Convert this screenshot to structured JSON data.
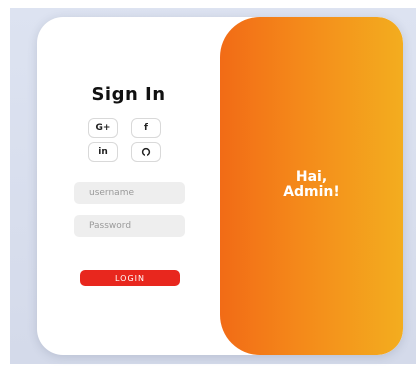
{
  "login": {
    "title": "Sign In",
    "social": [
      {
        "label": "G+",
        "icon": "google-plus-icon"
      },
      {
        "label": "f",
        "icon": "facebook-icon"
      },
      {
        "label": "in",
        "icon": "linkedin-icon"
      },
      {
        "label": "⚇",
        "icon": "github-icon"
      }
    ],
    "username_placeholder": "username",
    "password_placeholder": "Password",
    "login_label": "LOGIN"
  },
  "panel": {
    "greeting_line1": "Hai,",
    "greeting_line2": "Admin!"
  },
  "colors": {
    "accent_start": "#f26b16",
    "accent_end": "#f3ad1f",
    "login_button": "#e8271e"
  }
}
